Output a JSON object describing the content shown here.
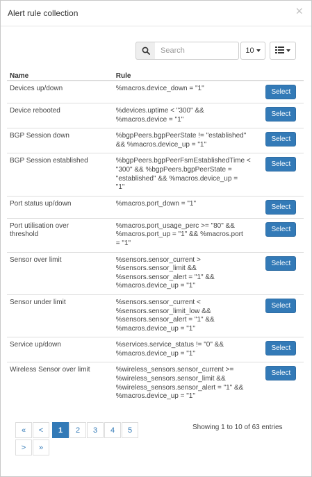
{
  "modal": {
    "title": "Alert rule collection",
    "close_glyph": "×"
  },
  "toolbar": {
    "search_placeholder": "Search",
    "page_size": "10"
  },
  "table": {
    "headers": {
      "name": "Name",
      "rule": "Rule"
    },
    "select_label": "Select",
    "rows": [
      {
        "name": "Devices up/down",
        "rule": [
          "%macros.device_down = \"1\""
        ]
      },
      {
        "name": "Device rebooted",
        "rule": [
          "%devices.uptime < \"300\" &&",
          "%macros.device = \"1\""
        ]
      },
      {
        "name": "BGP Session down",
        "rule": [
          "%bgpPeers.bgpPeerState != \"established\"",
          "&& %macros.device_up = \"1\""
        ]
      },
      {
        "name": "BGP Session established",
        "rule": [
          "%bgpPeers.bgpPeerFsmEstablishedTime <",
          "\"300\" && %bgpPeers.bgpPeerState =",
          "\"established\" && %macros.device_up =",
          "\"1\""
        ]
      },
      {
        "name": "Port status up/down",
        "rule": [
          "%macros.port_down = \"1\""
        ]
      },
      {
        "name": [
          "Port utilisation over",
          "threshold"
        ],
        "rule": [
          "%macros.port_usage_perc >= \"80\" &&",
          "%macros.port_up = \"1\" && %macros.port",
          "= \"1\""
        ]
      },
      {
        "name": "Sensor over limit",
        "rule": [
          "%sensors.sensor_current >",
          "%sensors.sensor_limit &&",
          "%sensors.sensor_alert = \"1\" &&",
          "%macros.device_up = \"1\""
        ]
      },
      {
        "name": "Sensor under limit",
        "rule": [
          "%sensors.sensor_current <",
          "%sensors.sensor_limit_low &&",
          "%sensors.sensor_alert = \"1\" &&",
          "%macros.device_up = \"1\""
        ]
      },
      {
        "name": "Service up/down",
        "rule": [
          "%services.service_status != \"0\" &&",
          "%macros.device_up = \"1\""
        ]
      },
      {
        "name": "Wireless Sensor over limit",
        "rule": [
          "%wireless_sensors.sensor_current >=",
          "%wireless_sensors.sensor_limit &&",
          "%wireless_sensors.sensor_alert = \"1\" &&",
          "%macros.device_up = \"1\""
        ]
      }
    ]
  },
  "pagination": {
    "first": "«",
    "prev": "<",
    "pages": [
      "1",
      "2",
      "3",
      "4",
      "5"
    ],
    "active_page": "1",
    "next": ">",
    "last": "»",
    "info": "Showing 1 to 10 of 63 entries"
  },
  "icons": {
    "search": "search-icon",
    "columns": "list-columns-icon",
    "close": "close-icon"
  },
  "colors": {
    "primary": "#337ab7",
    "border": "#dddddd",
    "text": "#333333"
  }
}
